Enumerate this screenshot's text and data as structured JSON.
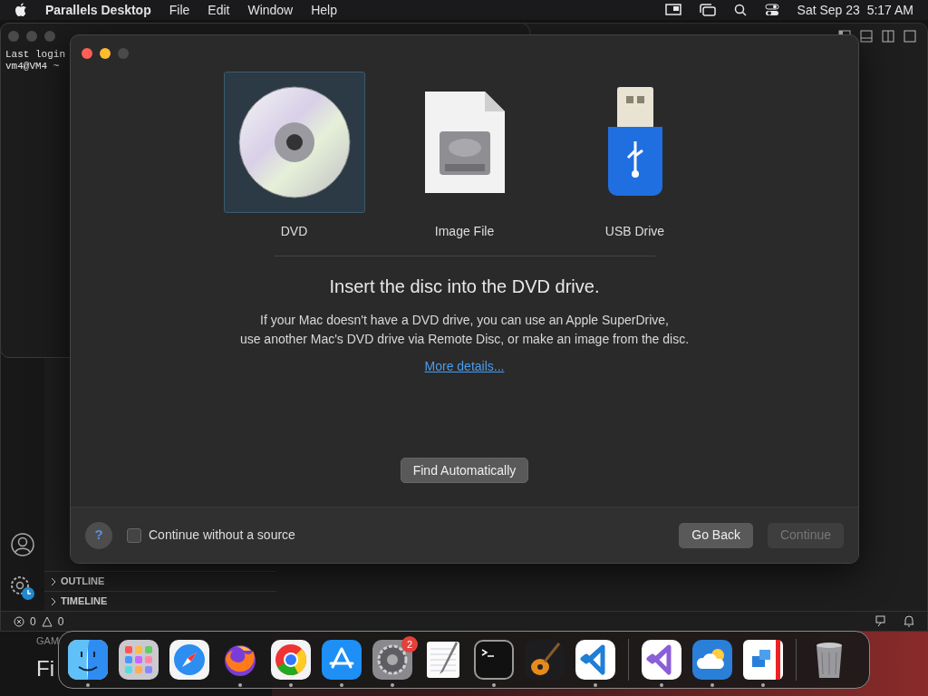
{
  "menu_bar": {
    "app_name": "Parallels Desktop",
    "menus": [
      "File",
      "Edit",
      "Window",
      "Help"
    ],
    "clock": "Sat Sep 23  5:17 AM"
  },
  "terminal": {
    "lines": [
      "Last login",
      "vm4@VM4 ~"
    ]
  },
  "editor": {
    "sections": [
      {
        "label": "OUTLINE",
        "expanded": false
      },
      {
        "label": "TIMELINE",
        "expanded": false
      }
    ],
    "errors": "0",
    "warnings": "0"
  },
  "desktop": {
    "texts": [
      "GAM",
      "Fi"
    ]
  },
  "dialog": {
    "sources": [
      {
        "label": "DVD",
        "kind": "dvd",
        "selected": true
      },
      {
        "label": "Image File",
        "kind": "image",
        "selected": false
      },
      {
        "label": "USB Drive",
        "kind": "usb",
        "selected": false
      }
    ],
    "heading": "Insert the disc into the DVD drive.",
    "body": [
      "If your Mac doesn't have a DVD drive, you can use an Apple SuperDrive,",
      "use another Mac's DVD drive via Remote Disc, or make an image from the disc."
    ],
    "link": "More details...",
    "find_button": "Find Automatically",
    "help_button": "?",
    "checkbox": {
      "label": "Continue without a source",
      "checked": false
    },
    "back_button": "Go Back",
    "continue_button": {
      "label": "Continue",
      "disabled": true
    }
  },
  "dock": {
    "apps": [
      {
        "kind": "finder",
        "running": true
      },
      {
        "kind": "launchpad",
        "running": false
      },
      {
        "kind": "safari",
        "running": false
      },
      {
        "kind": "firefox",
        "running": true
      },
      {
        "kind": "chrome",
        "running": true
      },
      {
        "kind": "appstore",
        "running": true
      },
      {
        "kind": "settings",
        "running": true,
        "badge": "2"
      },
      {
        "kind": "textedit",
        "running": false
      },
      {
        "kind": "terminal",
        "running": true
      },
      {
        "kind": "garageband",
        "running": false
      },
      {
        "kind": "vscode",
        "running": true
      },
      {
        "kind": "separator"
      },
      {
        "kind": "visualstudio",
        "running": true
      },
      {
        "kind": "weather",
        "running": true
      },
      {
        "kind": "parallels",
        "running": true
      },
      {
        "kind": "separator"
      },
      {
        "kind": "trash",
        "running": false
      }
    ]
  }
}
